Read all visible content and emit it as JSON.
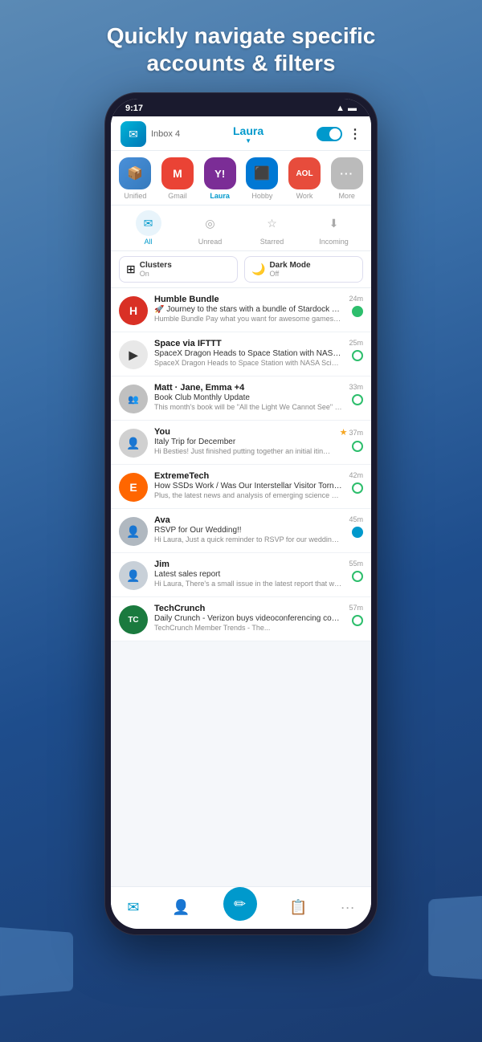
{
  "headline": {
    "line1": "Quickly navigate specific",
    "line2": "accounts & filters"
  },
  "status_bar": {
    "time": "9:17",
    "wifi_icon": "wifi",
    "signal_icon": "signal",
    "battery_icon": "battery"
  },
  "app_header": {
    "app_icon": "✉",
    "inbox_label": "Inbox 4",
    "account_name": "Laura",
    "more_icon": "⋮"
  },
  "account_tabs": [
    {
      "label": "Unified",
      "color": "#4a90d9",
      "icon": "📦"
    },
    {
      "label": "Gmail",
      "color": "#ea4335",
      "icon": "M"
    },
    {
      "label": "Laura",
      "color": "#7b2d96",
      "icon": "Y!",
      "active": true
    },
    {
      "label": "Hobby",
      "color": "#0078d4",
      "icon": "⬛"
    },
    {
      "label": "Work",
      "color": "#e74c3c",
      "icon": "AOL"
    },
    {
      "label": "More",
      "color": "#bbb",
      "icon": "···"
    }
  ],
  "filters": [
    {
      "label": "All",
      "icon": "✉",
      "active": true
    },
    {
      "label": "Unread",
      "icon": "◎",
      "active": false
    },
    {
      "label": "Starred",
      "icon": "☆",
      "active": false
    },
    {
      "label": "Incoming",
      "icon": "⤓",
      "active": false
    }
  ],
  "features": [
    {
      "name": "Clusters",
      "status": "On",
      "icon": "+"
    },
    {
      "name": "Dark Mode",
      "status": "Off",
      "icon": "🌙"
    }
  ],
  "emails": [
    {
      "sender": "Humble Bundle",
      "subject": "🚀 Journey to the stars with a bundle of Stardock strategy …",
      "preview": "Humble Bundle Pay what you want for awesome games a...",
      "time": "24m",
      "avatar_color": "#d93025",
      "avatar_text": "H",
      "dot_type": "green"
    },
    {
      "sender": "Space via IFTTT",
      "subject": "SpaceX Dragon Heads to Space Station with NASA Scienc...",
      "preview": "SpaceX Dragon Heads to Space Station with NASA Scienc...",
      "time": "25m",
      "avatar_color": "#e8e8e8",
      "avatar_text": "▶",
      "avatar_text_color": "#333",
      "dot_type": "green"
    },
    {
      "sender": "Matt · Jane, Emma +4",
      "subject": "Book Club Monthly Update",
      "preview": "This month's book will be \"All the Light We Cannot See\" by …",
      "time": "33m",
      "avatar_color": "#e8e8e8",
      "avatar_text": "👥",
      "dot_type": "green"
    },
    {
      "sender": "You",
      "subject": "Italy Trip for December",
      "preview": "Hi Besties! Just finished putting together an initial itinerary...",
      "time": "37m",
      "avatar_color": "#e8e8e8",
      "avatar_text": "👤",
      "dot_type": "green",
      "starred": true
    },
    {
      "sender": "ExtremeTech",
      "subject": "How SSDs Work / Was Our Interstellar Visitor Torn Apart b...",
      "preview": "Plus, the latest news and analysis of emerging science an...",
      "time": "42m",
      "avatar_color": "#ff6600",
      "avatar_text": "E",
      "dot_type": "green"
    },
    {
      "sender": "Ava",
      "subject": "RSVP for Our Wedding!!",
      "preview": "Hi Laura, Just a quick reminder to RSVP for our wedding. I'll nee...",
      "time": "45m",
      "avatar_color": "#e8e8e8",
      "avatar_text": "👤",
      "dot_type": "blue_fill"
    },
    {
      "sender": "Jim",
      "subject": "Latest sales report",
      "preview": "Hi Laura, There's a small issue in the latest report that was...",
      "time": "55m",
      "avatar_color": "#e8e8e8",
      "avatar_text": "👤",
      "dot_type": "green"
    },
    {
      "sender": "TechCrunch",
      "subject": "Daily Crunch - Verizon buys videoconferencing company B...",
      "preview": "TechCrunch Member Trends - The...",
      "time": "57m",
      "avatar_color": "#1a7a3e",
      "avatar_text": "TC",
      "dot_type": "green"
    }
  ],
  "bottom_nav": [
    {
      "icon": "✉",
      "label": "inbox",
      "active": true
    },
    {
      "icon": "👤",
      "label": "contacts",
      "active": false
    },
    {
      "icon": "✏",
      "label": "compose",
      "active": false,
      "special": true
    },
    {
      "icon": "📋",
      "label": "tasks",
      "active": false
    },
    {
      "icon": "···",
      "label": "more",
      "active": false
    }
  ]
}
